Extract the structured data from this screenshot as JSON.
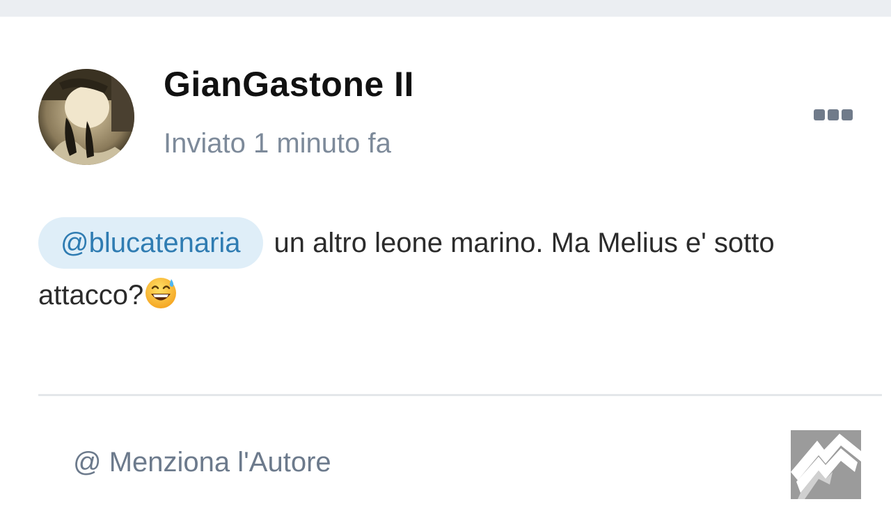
{
  "post": {
    "author": "GianGastone II",
    "time": "Inviato 1 minuto fa",
    "mention": "@blucatenaria",
    "text": "un altro leone marino. Ma Melius e' sotto attacco?",
    "emoji_icon": "grinning-face-with-sweat-icon"
  },
  "footer": {
    "mention_author": "@ Menziona l'Autore"
  },
  "icons": {
    "more": "ellipsis-icon",
    "logo": "m-logo-icon"
  },
  "colors": {
    "mention_bg": "#dfeef8",
    "mention_text": "#2f7cb2",
    "muted_text": "#7d8a9a"
  }
}
